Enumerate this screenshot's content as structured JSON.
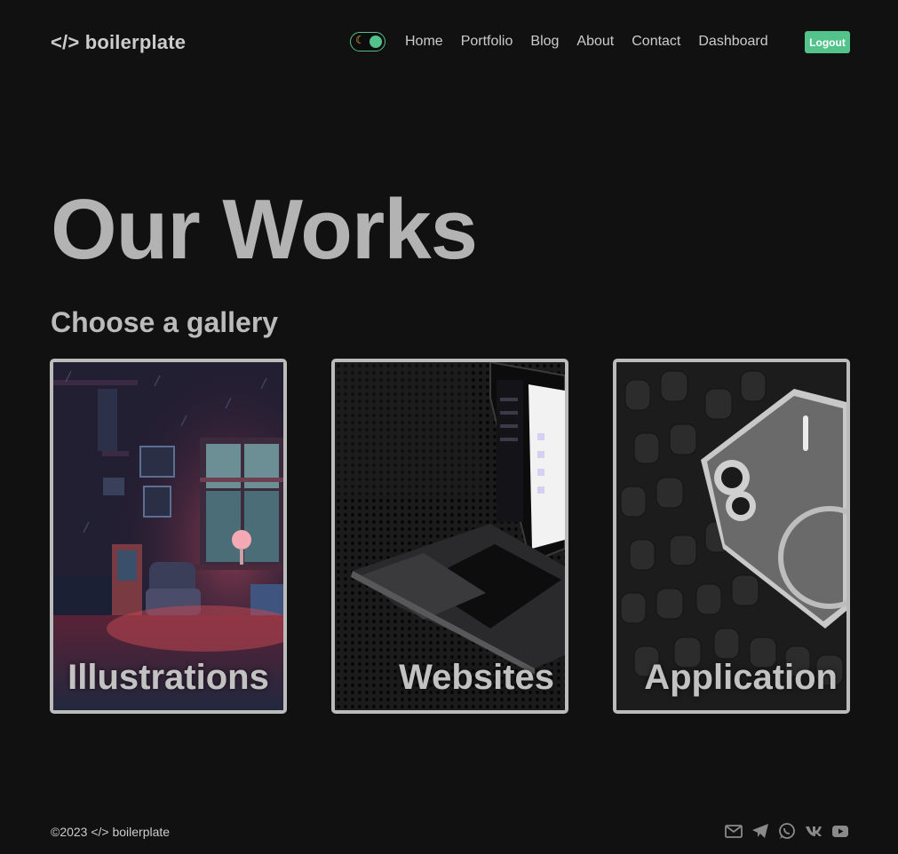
{
  "header": {
    "logo": "</> boilerplate",
    "theme_toggle_icon": "moon-icon",
    "nav": [
      {
        "label": "Home"
      },
      {
        "label": "Portfolio"
      },
      {
        "label": "Blog"
      },
      {
        "label": "About"
      },
      {
        "label": "Contact"
      },
      {
        "label": "Dashboard"
      }
    ],
    "logout_label": "Logout"
  },
  "main": {
    "title": "Our Works",
    "subtitle": "Choose a gallery",
    "galleries": [
      {
        "label": "Illustrations",
        "image": "pixel-art-room-image"
      },
      {
        "label": "Websites",
        "image": "laptop-image"
      },
      {
        "label": "Application",
        "image": "phone-image"
      }
    ]
  },
  "footer": {
    "copyright": "©2023 </> boilerplate",
    "socials": [
      "mail-icon",
      "telegram-icon",
      "whatsapp-icon",
      "vk-icon",
      "youtube-icon"
    ]
  },
  "colors": {
    "background": "#111111",
    "accent": "#53c28b",
    "text": "#bbbbbb"
  }
}
